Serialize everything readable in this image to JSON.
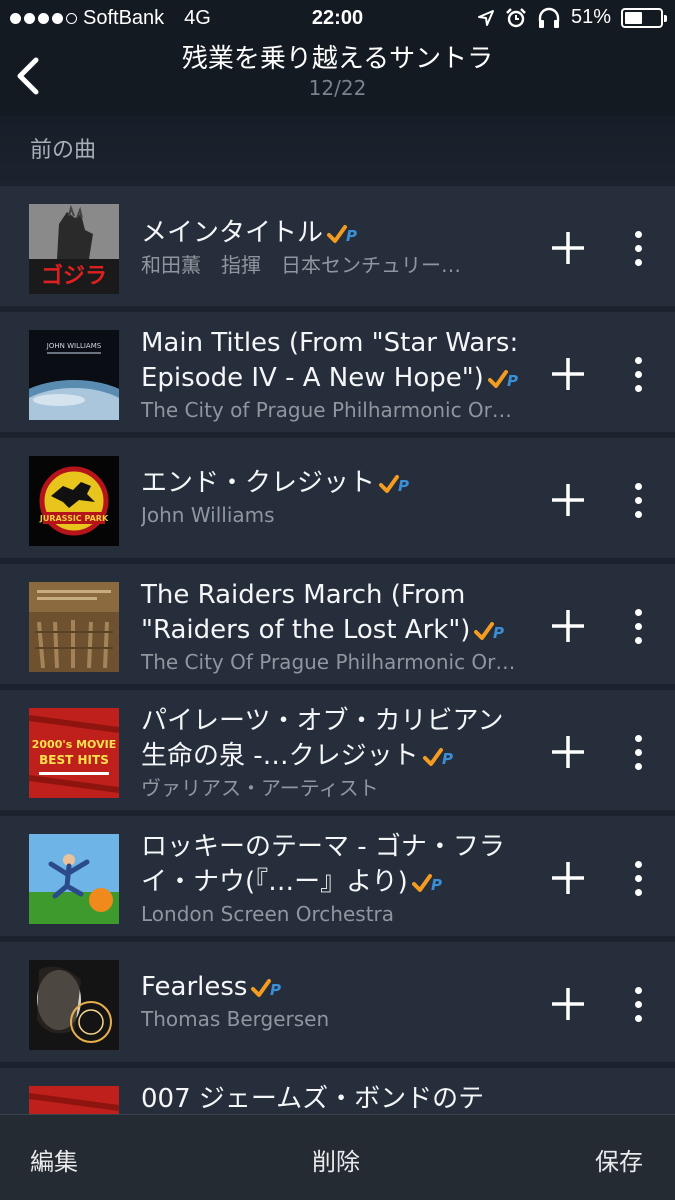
{
  "status_bar": {
    "carrier": "SoftBank",
    "network": "4G",
    "time": "22:00",
    "battery": "51%",
    "battery_level": 0.51,
    "icons": [
      "signal-dots-icon",
      "location-arrow-icon",
      "alarm-icon",
      "headphones-icon",
      "battery-icon"
    ]
  },
  "header": {
    "title": "残業を乗り越えるサントラ",
    "subtitle": "12/22",
    "back_icon": "chevron-left-icon"
  },
  "prev_label": "前の曲",
  "tracks": [
    {
      "title": "メインタイトル",
      "artist": "和田薫　指揮　日本センチュリー…",
      "art": "godzilla"
    },
    {
      "title": "Main Titles (From \"Star Wars: Episode IV - A New Hope\")",
      "artist": "The City of Prague Philharmonic Or…",
      "art": "starwars"
    },
    {
      "title": "エンド・クレジット",
      "artist": "John Williams",
      "art": "jurassic"
    },
    {
      "title": "The Raiders March (From \"Raiders of the Lost Ark\")",
      "artist": "The City Of Prague Philharmonic Or…",
      "art": "raiders"
    },
    {
      "title": "パイレーツ・オブ・カリビアン 生命の泉 -…クレジット",
      "artist": "ヴァリアス・アーティスト",
      "art": "movie2000"
    },
    {
      "title": "ロッキーのテーマ - ゴナ・フライ・ナウ(『…ー』より)",
      "artist": "London Screen Orchestra",
      "art": "rocky"
    },
    {
      "title": "Fearless",
      "artist": "Thomas Bergersen",
      "art": "fearless"
    },
    {
      "title": "007 ジェームズ・ボンドのテ",
      "artist": "",
      "art": "bond"
    }
  ],
  "art_texts": {
    "godzilla": "ゴジラ",
    "starwars_line1": "JOHN WILLIAMS",
    "jurassic": "JURASSIC PARK",
    "movie2000_line1": "2000's MOVIE",
    "movie2000_line2": "BEST HITS"
  },
  "bottom_bar": {
    "edit": "編集",
    "delete": "削除",
    "save": "保存"
  },
  "colors": {
    "background": "#1b232e",
    "row": "#252e3a",
    "prime_orange": "#f39c21",
    "prime_blue": "#3b8fd6"
  }
}
